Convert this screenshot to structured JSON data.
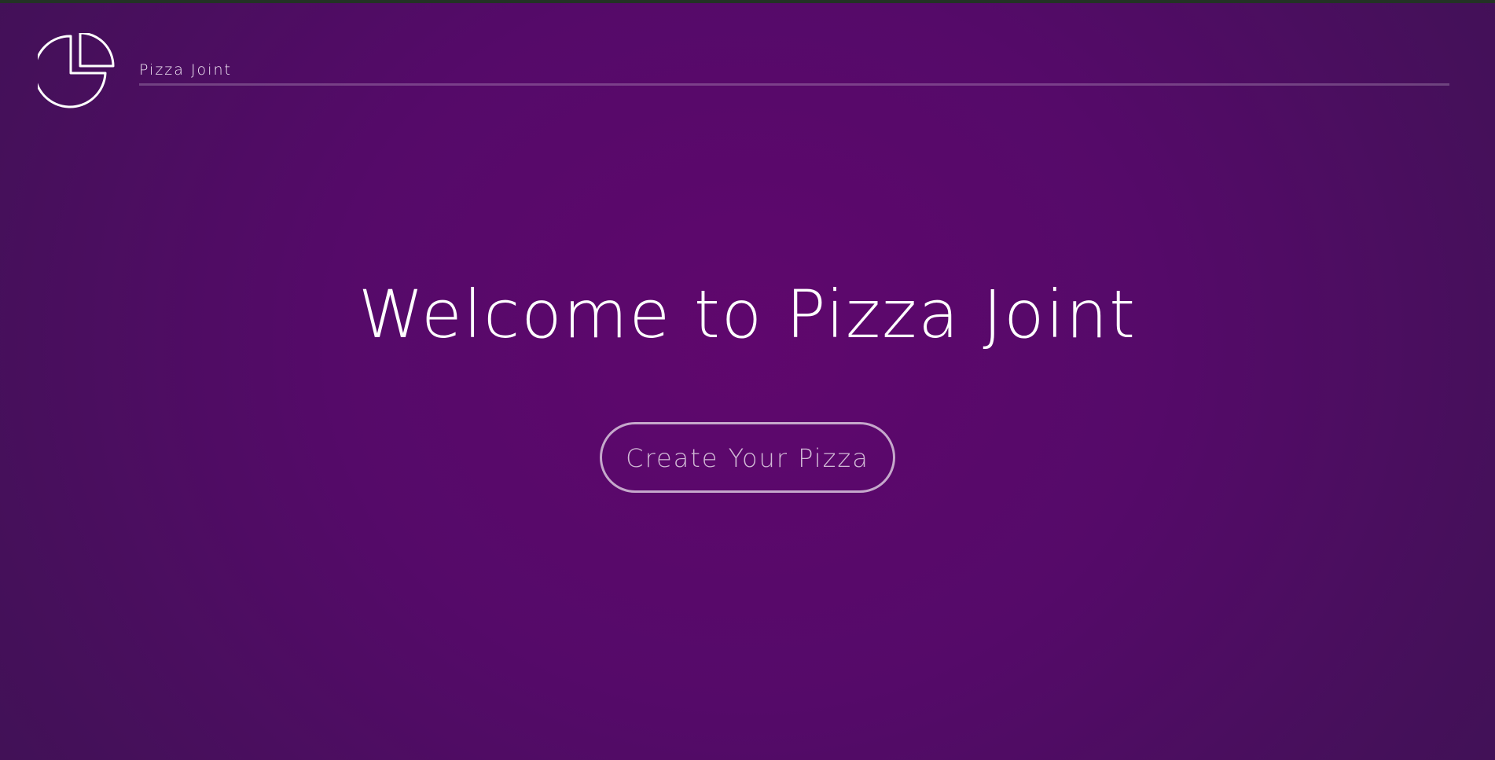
{
  "header": {
    "brand_name": "Pizza Joint",
    "logo_icon": "pie-chart-icon"
  },
  "hero": {
    "title": "Welcome to Pizza Joint",
    "cta_label": "Create Your Pizza"
  },
  "colors": {
    "background_center": "#5f076d",
    "background_edge": "#3c1352",
    "text": "#ffffff"
  }
}
